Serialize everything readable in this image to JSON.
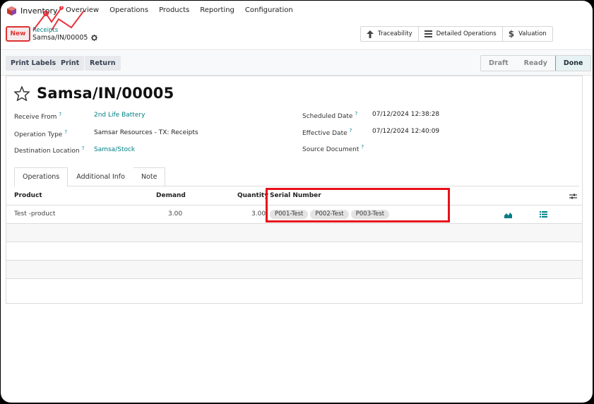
{
  "navbar": {
    "app_name": "Inventory",
    "menu": [
      "Overview",
      "Operations",
      "Products",
      "Reporting",
      "Configuration"
    ]
  },
  "control_panel": {
    "new_label": "New",
    "breadcrumb": "Receipts",
    "record_name": "Samsa/IN/00005",
    "smart_buttons": {
      "traceability": "Traceability",
      "detailed_operations": "Detailed Operations",
      "valuation": "Valuation"
    }
  },
  "actions": {
    "print_labels": "Print Labels",
    "print": "Print",
    "return": "Return"
  },
  "statusbar": {
    "draft": "Draft",
    "ready": "Ready",
    "done": "Done",
    "active": "Done"
  },
  "form": {
    "title": "Samsa/IN/00005",
    "receive_from_label": "Receive From",
    "receive_from": "2nd Life Battery",
    "operation_type_label": "Operation Type",
    "operation_type": "Samsar Resources - TX: Receipts",
    "destination_label": "Destination Location",
    "destination": "Samsa/Stock",
    "scheduled_label": "Scheduled Date",
    "scheduled": "07/12/2024 12:38:28",
    "effective_label": "Effective Date",
    "effective": "07/12/2024 12:40:09",
    "source_label": "Source Document",
    "help_mark": "?"
  },
  "tabs": {
    "operations": "Operations",
    "additional_info": "Additional Info",
    "note": "Note"
  },
  "table": {
    "headers": {
      "product": "Product",
      "demand": "Demand",
      "quantity": "Quantity",
      "serial": "Serial Number"
    },
    "rows": [
      {
        "product": "Test -product",
        "demand": "3.00",
        "quantity": "3.00",
        "serials": [
          "P001-Test",
          "P002-Test",
          "P003-Test"
        ]
      }
    ]
  },
  "colors": {
    "accent": "#017e84",
    "highlight": "#e8101a",
    "new_border": "#d33"
  }
}
